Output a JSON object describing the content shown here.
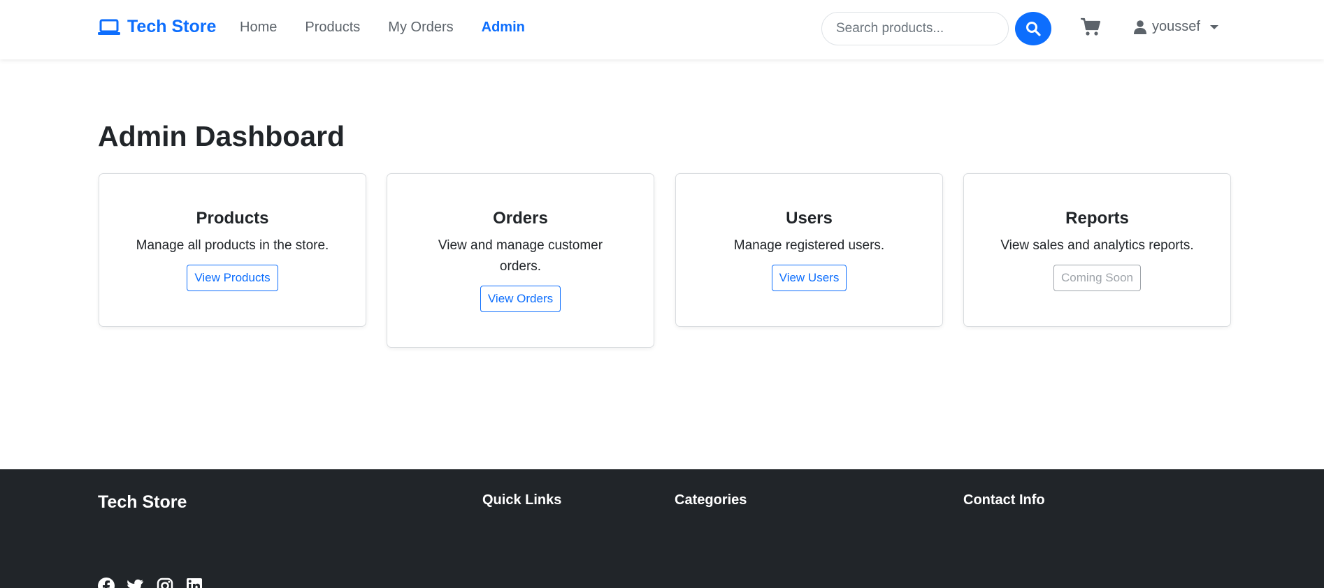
{
  "nav": {
    "brand": "Tech Store",
    "links": [
      {
        "label": "Home",
        "active": false
      },
      {
        "label": "Products",
        "active": false
      },
      {
        "label": "My Orders",
        "active": false
      },
      {
        "label": "Admin",
        "active": true
      }
    ],
    "search_placeholder": "Search products...",
    "user": "youssef",
    "icons": {
      "brand": "laptop-icon",
      "search": "search-icon",
      "cart": "cart-icon",
      "user": "user-icon"
    }
  },
  "main": {
    "title": "Admin Dashboard",
    "cards": [
      {
        "title": "Products",
        "text": "Manage all products in the store.",
        "button": "View Products",
        "disabled": false
      },
      {
        "title": "Orders",
        "text": "View and manage customer orders.",
        "button": "View Orders",
        "disabled": false
      },
      {
        "title": "Users",
        "text": "Manage registered users.",
        "button": "View Users",
        "disabled": false
      },
      {
        "title": "Reports",
        "text": "View sales and analytics reports.",
        "button": "Coming Soon",
        "disabled": true
      }
    ]
  },
  "footer": {
    "brand": "Tech Store",
    "headings": [
      "Quick Links",
      "Categories",
      "Contact Info"
    ],
    "social_icons": [
      "facebook-icon",
      "twitter-icon",
      "instagram-icon",
      "linkedin-icon"
    ]
  },
  "colors": {
    "primary": "#0d6efd",
    "dark": "#212529",
    "muted": "#6c757d"
  }
}
